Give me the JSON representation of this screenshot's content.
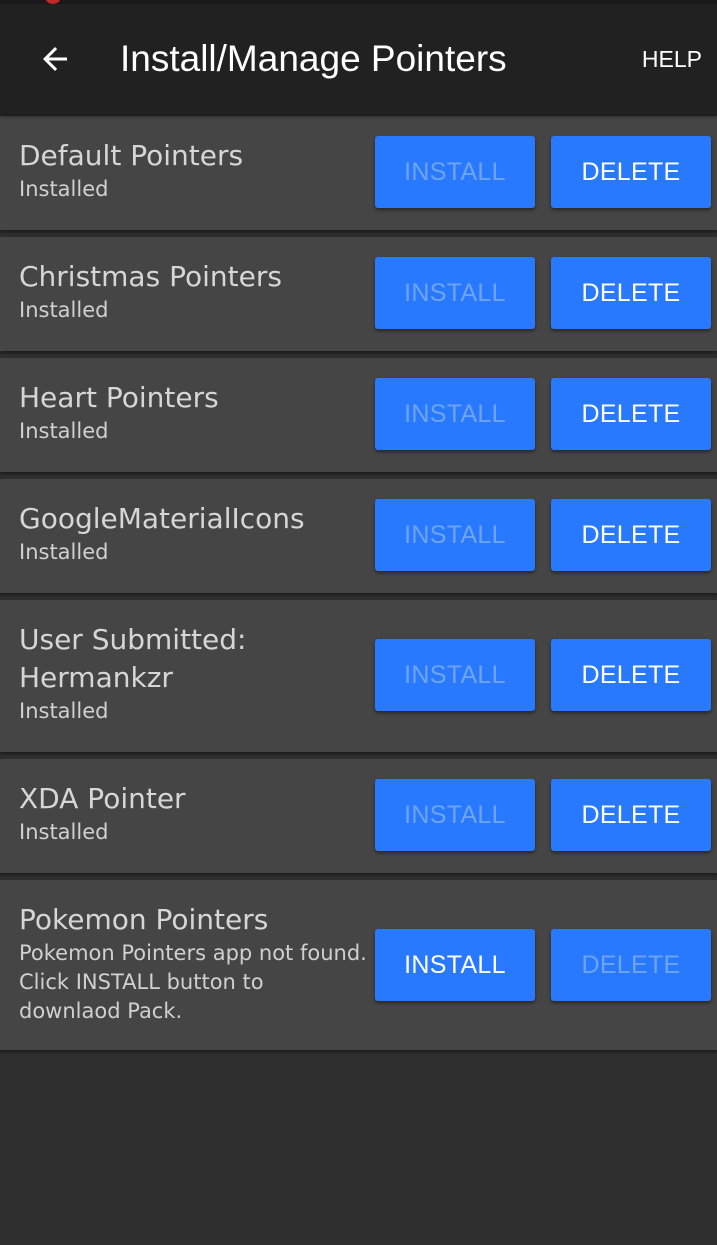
{
  "app_bar": {
    "title": "Install/Manage Pointers",
    "back_icon": "arrow-left-icon",
    "help_label": "HELP"
  },
  "colors": {
    "app_bar": "#212121",
    "background": "#2f2f2f",
    "card": "#454545",
    "button": "#2979ff",
    "button_text_enabled": "#ffffff",
    "button_text_disabled": "#6ea4ef"
  },
  "packs": [
    {
      "name": "Default Pointers",
      "status": "Installed",
      "install_label": "INSTALL",
      "delete_label": "DELETE",
      "install_enabled": false,
      "delete_enabled": true
    },
    {
      "name": "Christmas Pointers",
      "status": "Installed",
      "install_label": "INSTALL",
      "delete_label": "DELETE",
      "install_enabled": false,
      "delete_enabled": true
    },
    {
      "name": "Heart Pointers",
      "status": "Installed",
      "install_label": "INSTALL",
      "delete_label": "DELETE",
      "install_enabled": false,
      "delete_enabled": true
    },
    {
      "name": "GoogleMaterialIcons",
      "status": "Installed",
      "install_label": "INSTALL",
      "delete_label": "DELETE",
      "install_enabled": false,
      "delete_enabled": true
    },
    {
      "name": "User Submitted: Hermankzr",
      "status": "Installed",
      "install_label": "INSTALL",
      "delete_label": "DELETE",
      "install_enabled": false,
      "delete_enabled": true
    },
    {
      "name": "XDA Pointer",
      "status": "Installed",
      "install_label": "INSTALL",
      "delete_label": "DELETE",
      "install_enabled": false,
      "delete_enabled": true
    },
    {
      "name": "Pokemon Pointers",
      "status": "Pokemon Pointers app not found. Click INSTALL button to downlaod Pack.",
      "install_label": "INSTALL",
      "delete_label": "DELETE",
      "install_enabled": true,
      "delete_enabled": false
    }
  ]
}
